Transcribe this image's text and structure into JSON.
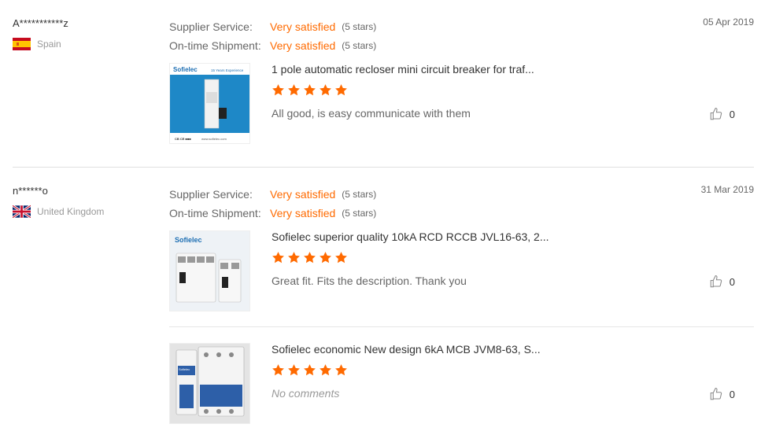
{
  "reviews": [
    {
      "buyer": "A***********z",
      "country": "Spain",
      "flag": "spain",
      "date": "05 Apr 2019",
      "supplier_service": {
        "label": "Supplier Service:",
        "value": "Very satisfied",
        "stars": "(5 stars)"
      },
      "shipment": {
        "label": "On-time Shipment:",
        "value": "Very satisfied",
        "stars": "(5 stars)"
      },
      "products": [
        {
          "title": "1 pole automatic recloser mini circuit breaker for traf...",
          "rating": 5,
          "comment": "All good, is easy communicate with them",
          "likes": "0",
          "thumb": {
            "brand": "Sofielec",
            "banner": "15 Years Experience",
            "footer": "www.sofielec.com"
          }
        }
      ]
    },
    {
      "buyer": "n******o",
      "country": "United Kingdom",
      "flag": "uk",
      "date": "31 Mar 2019",
      "supplier_service": {
        "label": "Supplier Service:",
        "value": "Very satisfied",
        "stars": "(5 stars)"
      },
      "shipment": {
        "label": "On-time Shipment:",
        "value": "Very satisfied",
        "stars": "(5 stars)"
      },
      "products": [
        {
          "title": "Sofielec superior quality 10kA RCD RCCB JVL16-63, 2...",
          "rating": 5,
          "comment": "Great fit. Fits the description. Thank you",
          "likes": "0",
          "thumb": {
            "brand": "Sofielec"
          }
        },
        {
          "title": "Sofielec economic New design 6kA MCB JVM8-63, S...",
          "rating": 5,
          "comment": "No comments",
          "likes": "0",
          "thumb": {
            "brand": "Sofielec"
          }
        }
      ]
    }
  ],
  "colors": {
    "accent": "#ff6a00",
    "star": "#ff6a00",
    "divider": "#e0e0e0"
  },
  "icons": {
    "like": "thumbs-up-icon",
    "star": "star-icon"
  }
}
